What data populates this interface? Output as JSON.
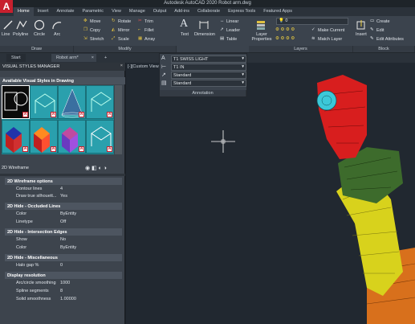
{
  "app": {
    "title": "Autodesk AutoCAD 2020    Robot arm.dwg",
    "logo_letter": "A"
  },
  "ribbon_tabs": [
    "Home",
    "Insert",
    "Annotate",
    "Parametric",
    "View",
    "Manage",
    "Output",
    "Add-ins",
    "Collaborate",
    "Express Tools",
    "Featured Apps"
  ],
  "ribbon": {
    "draw": {
      "title": "Draw",
      "line": "Line",
      "polyline": "Polyline",
      "circle": "Circle",
      "arc": "Arc"
    },
    "modify": {
      "title": "Modify",
      "move": "Move",
      "rotate": "Rotate",
      "trim": "Trim",
      "copy": "Copy",
      "mirror": "Mirror",
      "fillet": "Fillet",
      "stretch": "Stretch",
      "scale": "Scale",
      "array": "Array"
    },
    "annotation": {
      "text": "Text",
      "dimension": "Dimension",
      "linear": "Linear",
      "leader": "Leader",
      "table": "Table"
    },
    "layers": {
      "title": "Layers",
      "layer_properties": "Layer Properties",
      "make_current": "Make Current",
      "match_layer": "Match Layer",
      "layer_value": "0"
    },
    "block": {
      "title": "Block",
      "insert": "Insert",
      "create": "Create",
      "edit": "Edit",
      "edit_attributes": "Edit Attributes"
    }
  },
  "file_tabs": {
    "start": "Start",
    "current": "Robot arm*",
    "add": "+",
    "close": "×"
  },
  "annotation_dropdown": {
    "title": "Annotation",
    "text_style": "T1 SWISS LIGHT",
    "dim_style": "T1 IN",
    "multileader_style": "Standard",
    "table_style": "Standard"
  },
  "viewport": {
    "label": "[-][Custom View]"
  },
  "palette": {
    "title": "VISUAL STYLES MANAGER",
    "close": "×",
    "available_header": "Available Visual Styles in Drawing",
    "current_style": "2D Wireframe",
    "sections": [
      {
        "title": "2D Wireframe options",
        "rows": [
          {
            "key": "Contour lines",
            "value": "4"
          },
          {
            "key": "Draw true silhouett...",
            "value": "Yes"
          }
        ]
      },
      {
        "title": "2D Hide - Occluded Lines",
        "rows": [
          {
            "key": "Color",
            "value": "ByEntity"
          },
          {
            "key": "Linetype",
            "value": "Off"
          }
        ]
      },
      {
        "title": "2D Hide - Intersection Edges",
        "rows": [
          {
            "key": "Show",
            "value": "No"
          },
          {
            "key": "Color",
            "value": "ByEntity"
          }
        ]
      },
      {
        "title": "2D Hide - Miscellaneous",
        "rows": [
          {
            "key": "Halo gap %",
            "value": "0"
          }
        ]
      },
      {
        "title": "Display resolution",
        "rows": [
          {
            "key": "Arc/circle smoothing",
            "value": "1000"
          },
          {
            "key": "Spline segments",
            "value": "8"
          },
          {
            "key": "Solid smoothness",
            "value": "1.00000"
          }
        ]
      }
    ]
  },
  "colors": {
    "accent_red": "#c8202e",
    "thumb_teal": "#2aa0ad",
    "robot_red": "#d81e1e",
    "robot_green": "#3d6b2c",
    "robot_yellow": "#d8d21c",
    "robot_orange": "#d8701c",
    "robot_cyan": "#3cc8d8"
  }
}
